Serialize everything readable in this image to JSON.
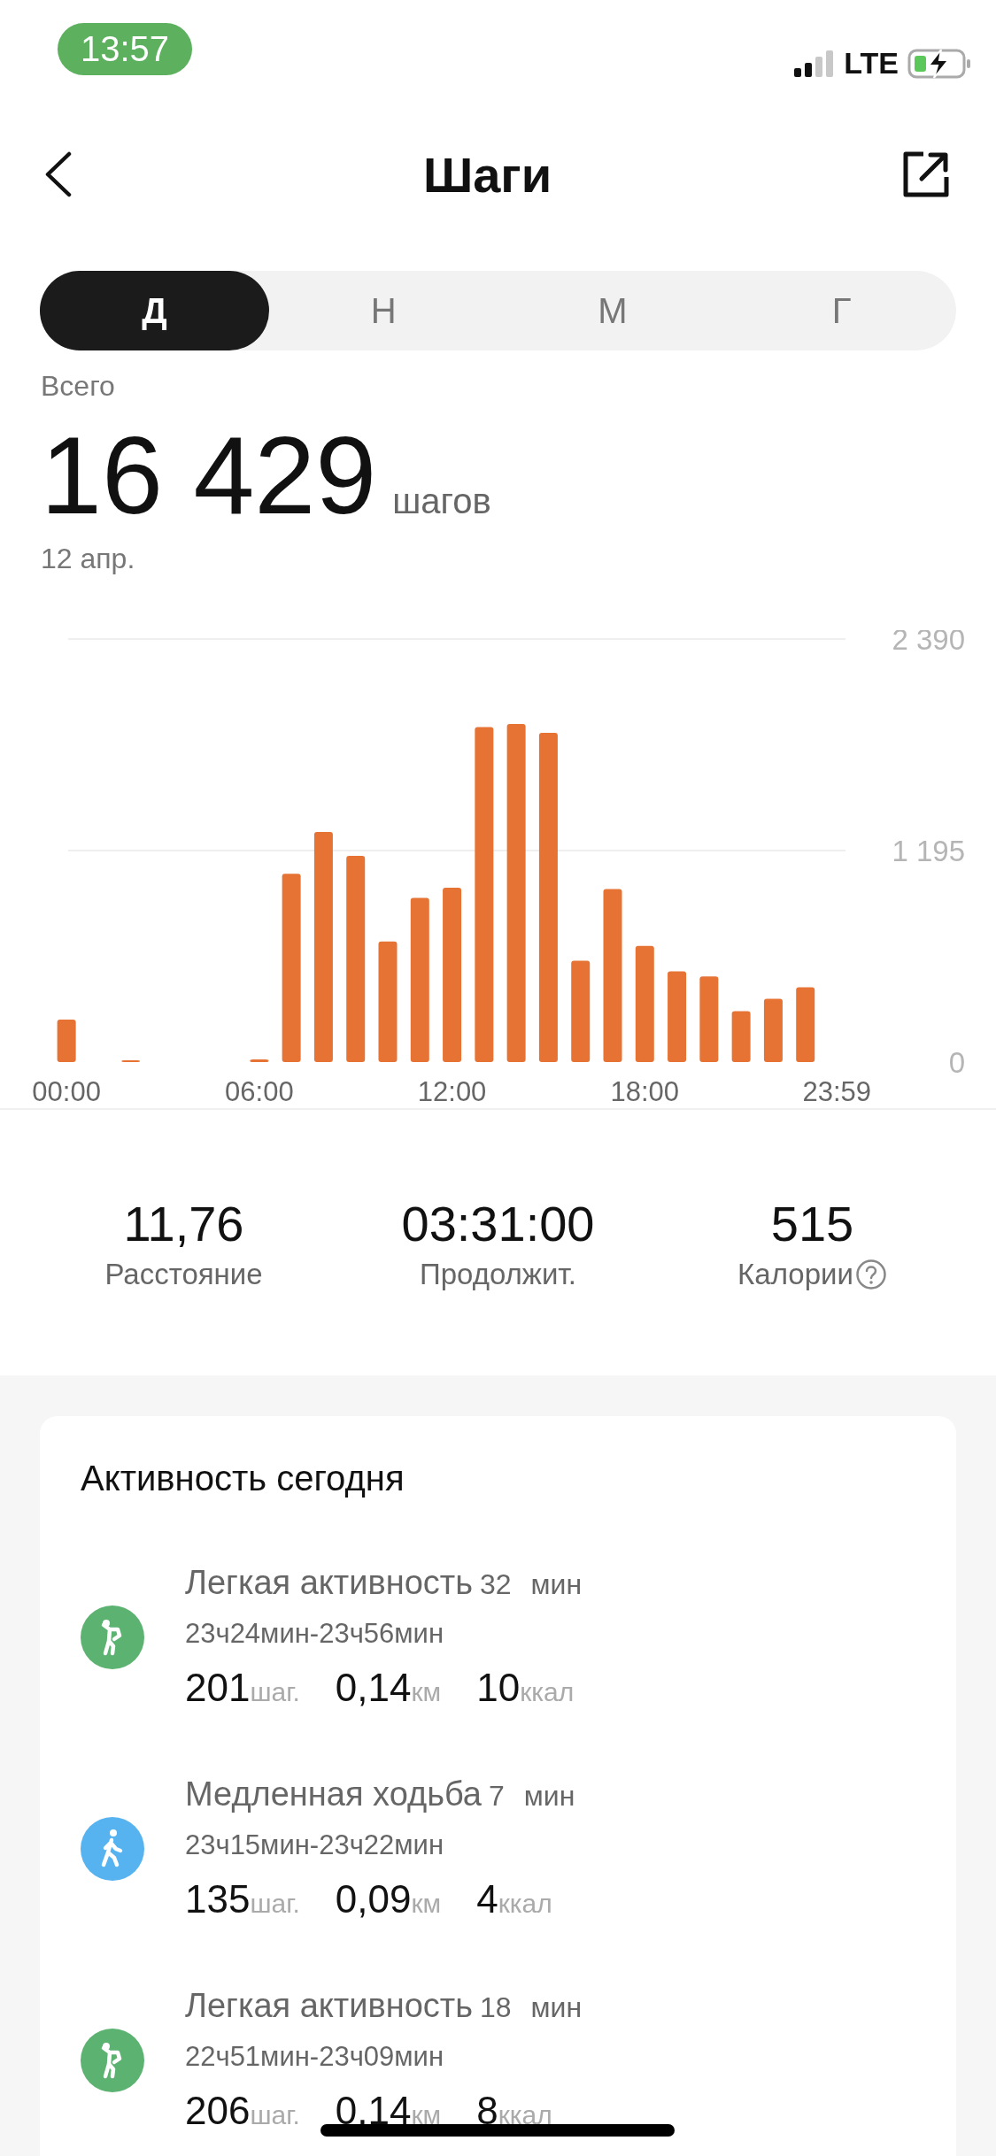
{
  "status_bar": {
    "time": "13:57",
    "network": "LTE"
  },
  "header": {
    "title": "Шаги"
  },
  "tabs": [
    {
      "label": "Д",
      "selected": true
    },
    {
      "label": "Н",
      "selected": false
    },
    {
      "label": "М",
      "selected": false
    },
    {
      "label": "Г",
      "selected": false
    }
  ],
  "summary": {
    "label": "Всего",
    "value": "16 429",
    "unit": "шагов",
    "date": "12 апр."
  },
  "chart_data": {
    "type": "bar",
    "x": [
      0,
      1,
      2,
      3,
      4,
      5,
      6,
      7,
      8,
      9,
      10,
      11,
      12,
      13,
      14,
      15,
      16,
      17,
      18,
      19,
      20,
      21,
      22,
      23
    ],
    "xlim": [
      -0.5,
      24
    ],
    "series": [
      {
        "color": "#e67334",
        "values": [
          240,
          0,
          10,
          0,
          0,
          0,
          15,
          1064,
          1300,
          1165,
          681,
          928,
          985,
          1892,
          1910,
          1860,
          573,
          978,
          656,
          512,
          484,
          287,
          358,
          423
        ]
      }
    ],
    "ylim": [
      0,
      2390
    ],
    "yticks": [
      {
        "value": 0,
        "label": "0"
      },
      {
        "value": 1195,
        "label": "1 195"
      },
      {
        "value": 2390,
        "label": "2 390"
      }
    ],
    "xticks": [
      {
        "value": 0,
        "label": "00:00"
      },
      {
        "value": 6,
        "label": "06:00"
      },
      {
        "value": 12,
        "label": "12:00"
      },
      {
        "value": 18,
        "label": "18:00"
      },
      {
        "value": 23.98,
        "label": "23:59"
      }
    ]
  },
  "stats": [
    {
      "value": "11,76",
      "label": "Расстояние"
    },
    {
      "value": "03:31:00",
      "label": "Продолжит."
    },
    {
      "value": "515",
      "label": "Калории",
      "help": true
    }
  ],
  "activity": {
    "title": "Активность сегодня",
    "items": [
      {
        "kind": "light",
        "name": "Легкая активность",
        "duration": "32",
        "duration_unit": "мин",
        "time": "23ч24мин-23ч56мин",
        "steps": "201",
        "steps_unit": "шаг.",
        "distance": "0,14",
        "distance_unit": "км",
        "calories": "10",
        "calories_unit": "ккал"
      },
      {
        "kind": "slow",
        "name": "Медленная ходьба",
        "duration": "7",
        "duration_unit": "мин",
        "time": "23ч15мин-23ч22мин",
        "steps": "135",
        "steps_unit": "шаг.",
        "distance": "0,09",
        "distance_unit": "км",
        "calories": "4",
        "calories_unit": "ккал"
      },
      {
        "kind": "light",
        "name": "Легкая активность",
        "duration": "18",
        "duration_unit": "мин",
        "time": "22ч51мин-23ч09мин",
        "steps": "206",
        "steps_unit": "шаг.",
        "distance": "0,14",
        "distance_unit": "км",
        "calories": "8",
        "calories_unit": "ккал"
      }
    ]
  }
}
